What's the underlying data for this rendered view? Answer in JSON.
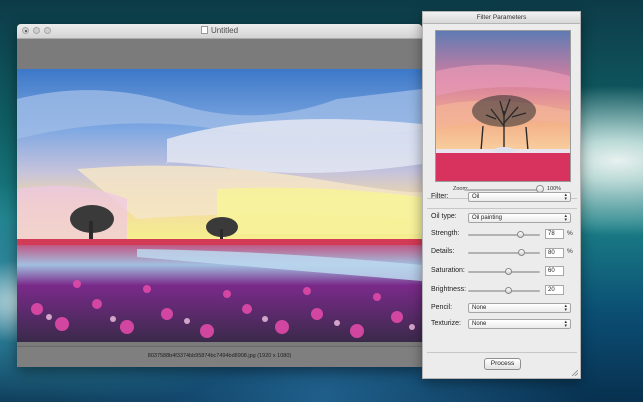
{
  "window": {
    "title": "Untitled",
    "status": "8037588b4f3374bb95874bc7494bd8908.jpg  (1920 x 1080)"
  },
  "panel": {
    "title": "Filter Parameters",
    "zoom": {
      "label": "Zoom:",
      "value": "100%",
      "level": 1.0
    },
    "filter": {
      "label": "Filter:",
      "selected": "Oil"
    },
    "oil_type": {
      "label": "Oil type:",
      "selected": "Oil painting"
    },
    "strength": {
      "label": "Strength:",
      "value": "78",
      "unit": "%",
      "level": 0.78
    },
    "details": {
      "label": "Details:",
      "value": "80",
      "unit": "%",
      "level": 0.8
    },
    "saturation": {
      "label": "Saturation:",
      "value": "60",
      "level": 0.6
    },
    "brightness": {
      "label": "Brightness:",
      "value": "20",
      "level": 0.6
    },
    "pencil": {
      "label": "Pencil:",
      "selected": "None"
    },
    "texturize": {
      "label": "Texturize:",
      "selected": "None"
    },
    "process_label": "Process"
  },
  "icons": {
    "close": "close-icon",
    "minimize": "minimize-icon",
    "maximize": "maximize-icon",
    "popup": "chevron-updown-icon",
    "resize": "resize-grip-icon"
  },
  "colors": {
    "window_gray": "#7b7b7b",
    "panel_bg": "#ececec"
  }
}
